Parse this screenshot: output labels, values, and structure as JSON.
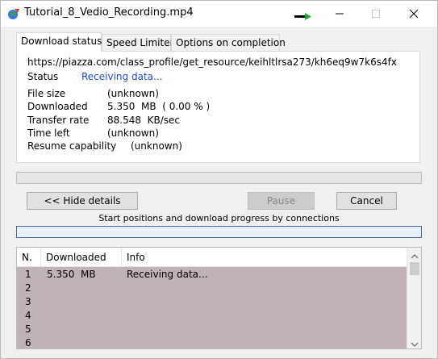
{
  "window": {
    "title": "Tutorial_8_Vedio_Recording.mp4"
  },
  "tabs": [
    {
      "label": "Download status",
      "active": true
    },
    {
      "label": "Speed Limiter",
      "active": false
    },
    {
      "label": "Options on completion",
      "active": false
    }
  ],
  "status": {
    "url": "https://piazza.com/class_profile/get_resource/keihltlrsa273/kh6eq9w7k6s4fx",
    "status_label": "Status",
    "status_value": "Receiving data...",
    "file_size_label": "File size",
    "file_size_value": "(unknown)",
    "downloaded_label": "Downloaded",
    "downloaded_value": "5.350  MB  ( 0.00 % )",
    "transfer_rate_label": "Transfer rate",
    "transfer_rate_value": "88.548  KB/sec",
    "time_left_label": "Time left",
    "time_left_value": "(unknown)",
    "resume_label": "Resume capability",
    "resume_value": "(unknown)"
  },
  "progress": {
    "main_fraction": 0.0
  },
  "buttons": {
    "hide_details": "<< Hide details",
    "pause": "Pause",
    "cancel": "Cancel"
  },
  "connections": {
    "caption": "Start positions and download progress by connections",
    "columns": [
      "N.",
      "Downloaded",
      "Info"
    ],
    "rows": [
      {
        "n": "1",
        "downloaded": "5.350  MB",
        "info": "Receiving data..."
      },
      {
        "n": "2",
        "downloaded": "",
        "info": ""
      },
      {
        "n": "3",
        "downloaded": "",
        "info": ""
      },
      {
        "n": "4",
        "downloaded": "",
        "info": ""
      },
      {
        "n": "5",
        "downloaded": "",
        "info": ""
      },
      {
        "n": "6",
        "downloaded": "",
        "info": ""
      }
    ]
  },
  "colors": {
    "status_link": "#1d4bd6",
    "list_background": "#bfb2b8",
    "connection_bar_border": "#4a6aa3"
  },
  "icons": {
    "app": "idm-globe-icon",
    "speed": "green-arrow-icon",
    "minimize": "minimize-icon",
    "maximize": "maximize-icon",
    "close": "close-icon"
  }
}
